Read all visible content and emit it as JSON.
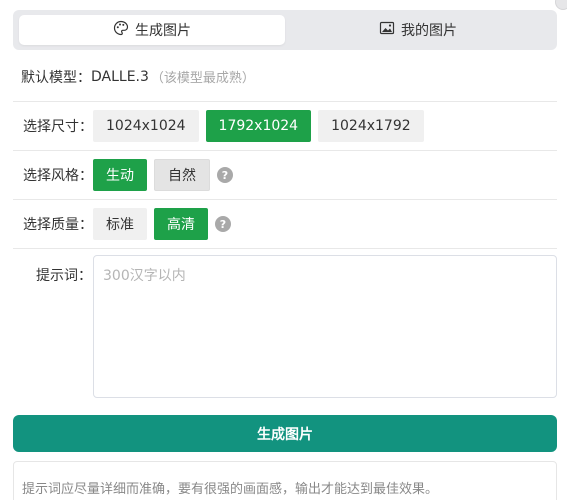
{
  "tabs": [
    {
      "label": "生成图片",
      "icon": "palette-icon",
      "active": true
    },
    {
      "label": "我的图片",
      "icon": "image-icon",
      "active": false
    }
  ],
  "model": {
    "label": "默认模型：",
    "value": "DALLE.3",
    "note": "（该模型最成熟）"
  },
  "size": {
    "label": "选择尺寸：",
    "options": [
      "1024x1024",
      "1792x1024",
      "1024x1792"
    ],
    "selected": "1792x1024"
  },
  "style": {
    "label": "选择风格：",
    "options": [
      "生动",
      "自然"
    ],
    "selected": "生动",
    "help": "?"
  },
  "quality": {
    "label": "选择质量：",
    "options": [
      "标准",
      "高清"
    ],
    "selected": "高清",
    "help": "?"
  },
  "prompt": {
    "label": "提示词：",
    "placeholder": "300汉字以内",
    "value": ""
  },
  "generate_button": "生成图片",
  "tip": "提示词应尽量详细而准确，要有很强的画面感，输出才能达到最佳效果。",
  "colors": {
    "accent_green": "#1ea149",
    "button_teal": "#12937f"
  }
}
